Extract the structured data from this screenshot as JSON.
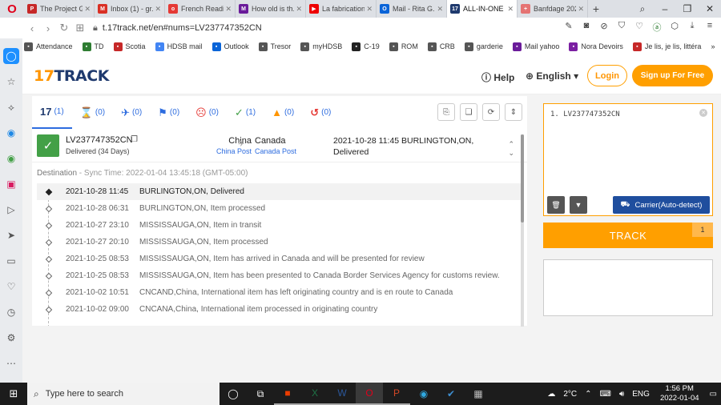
{
  "browser": {
    "tabs": [
      {
        "title": "The Project G...",
        "fav_color": "#c62828",
        "fav": "P"
      },
      {
        "title": "Inbox (1) - gr...",
        "fav_color": "#d93025",
        "fav": "M"
      },
      {
        "title": "French Readi...",
        "fav_color": "#e53935",
        "fav": "o"
      },
      {
        "title": "How old is th...",
        "fav_color": "#6a1b9a",
        "fav": "M"
      },
      {
        "title": "La fabrication",
        "fav_color": "#e00",
        "fav": "▶"
      },
      {
        "title": "Mail - Rita G...",
        "fav_color": "#0a64d8",
        "fav": "O"
      },
      {
        "title": "ALL-IN-ONE P...",
        "fav_color": "#1f3a6e",
        "fav": "17"
      },
      {
        "title": "Banfdage 202...",
        "fav_color": "#e57373",
        "fav": "+"
      }
    ],
    "active_tab_index": 6,
    "url": "t.17track.net/en#nums=LV237747352CN",
    "bookmarks": [
      {
        "label": "Attendance",
        "color": "#555"
      },
      {
        "label": "TD",
        "color": "#2e7d32"
      },
      {
        "label": "Scotia",
        "color": "#c62828"
      },
      {
        "label": "HDSB mail",
        "color": "#4285f4"
      },
      {
        "label": "Outlook",
        "color": "#0a64d8"
      },
      {
        "label": "Tresor",
        "color": "#555"
      },
      {
        "label": "myHDSB",
        "color": "#555"
      },
      {
        "label": "C-19",
        "color": "#222"
      },
      {
        "label": "ROM",
        "color": "#555"
      },
      {
        "label": "CRB",
        "color": "#555"
      },
      {
        "label": "garderie",
        "color": "#555"
      },
      {
        "label": "Mail yahoo",
        "color": "#6a1b9a"
      },
      {
        "label": "Nora Devoirs",
        "color": "#7b1fa2"
      },
      {
        "label": "Je lis, je lis, littéra",
        "color": "#c62828"
      }
    ]
  },
  "header": {
    "logo_prefix": "17",
    "logo_suffix": "TRACK",
    "help": "Help",
    "language": "English",
    "login": "Login",
    "signup": "Sign up For Free"
  },
  "status_tabs": [
    {
      "icon": "17",
      "count": "(1)",
      "name": "all"
    },
    {
      "icon": "⌛",
      "count": "(0)",
      "name": "not-found"
    },
    {
      "icon": "✈",
      "count": "(0)",
      "name": "in-transit"
    },
    {
      "icon": "⚑",
      "count": "(0)",
      "name": "pick-up"
    },
    {
      "icon": "☹",
      "count": "(0)",
      "name": "undelivered"
    },
    {
      "icon": "✓",
      "count": "(1)",
      "name": "delivered"
    },
    {
      "icon": "▲",
      "count": "(0)",
      "name": "alert"
    },
    {
      "icon": "↺",
      "count": "(0)",
      "name": "expired"
    }
  ],
  "result": {
    "tracking_number": "LV237747352CN",
    "status": "Delivered (34 Days)",
    "origin_country": "China",
    "origin_carrier": "China Post",
    "dest_country": "Canada",
    "dest_carrier": "Canada Post",
    "latest_event": "2021-10-28 11:45  BURLINGTON,ON, Delivered",
    "sync_label": "Destination",
    "sync_time": " - Sync Time: 2022-01-04 13:45:18 (GMT-05:00)",
    "events": [
      {
        "time": "2021-10-28 11:45",
        "desc": "BURLINGTON,ON, Delivered"
      },
      {
        "time": "2021-10-28 06:31",
        "desc": "BURLINGTON,ON, Item processed"
      },
      {
        "time": "2021-10-27 23:10",
        "desc": "MISSISSAUGA,ON, Item in transit"
      },
      {
        "time": "2021-10-27 20:10",
        "desc": "MISSISSAUGA,ON, Item processed"
      },
      {
        "time": "2021-10-25 08:53",
        "desc": "MISSISSAUGA,ON, Item has arrived in Canada and will be presented for review"
      },
      {
        "time": "2021-10-25 08:53",
        "desc": "MISSISSAUGA,ON, Item has been presented to Canada Border Services Agency for customs review."
      },
      {
        "time": "2021-10-02 10:51",
        "desc": "CNCAND,China, International item has left originating country and is en route to Canada"
      },
      {
        "time": "2021-10-02 09:00",
        "desc": "CNCANA,China, International item processed in originating country"
      }
    ]
  },
  "input_panel": {
    "text": "1. LV237747352CN",
    "carrier_button": "Carrier(Auto-detect)",
    "track_button": "TRACK",
    "track_count": "1"
  },
  "taskbar": {
    "search_placeholder": "Type here to search",
    "temperature": "2°C",
    "language": "ENG",
    "time": "1:56 PM",
    "date": "2022-01-04"
  }
}
